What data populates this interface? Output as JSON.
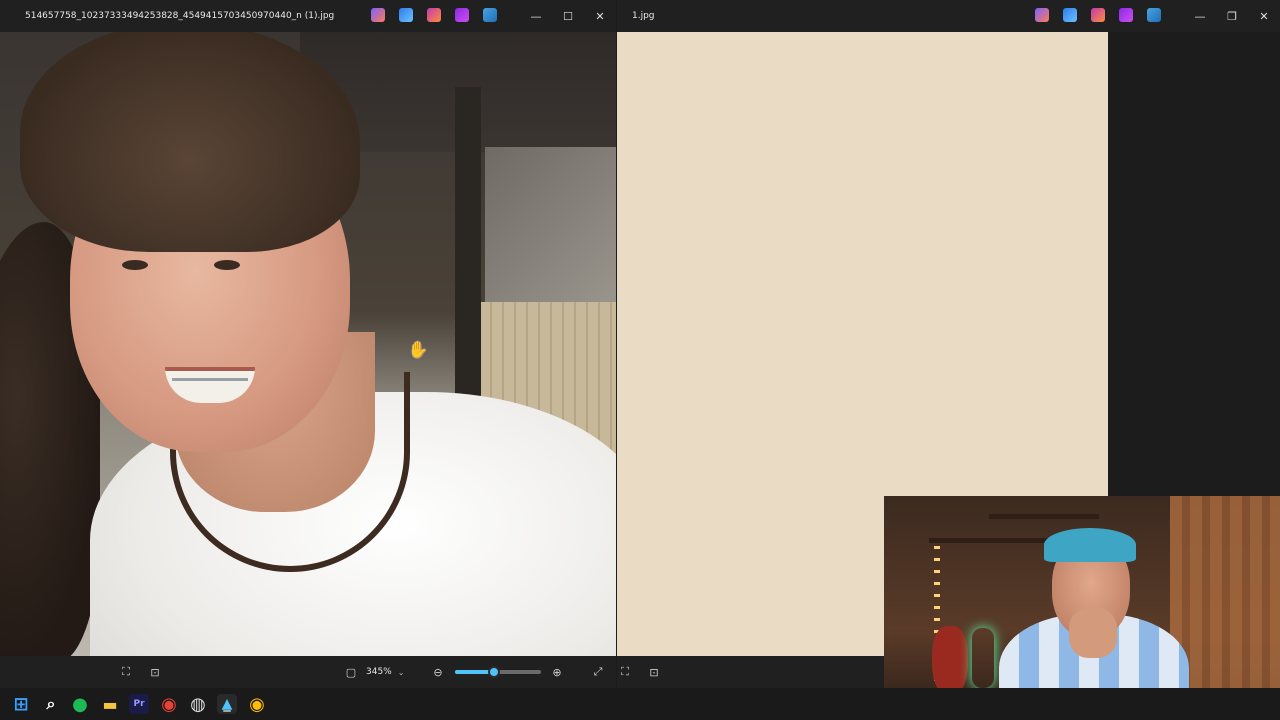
{
  "left_window": {
    "title": "514657758_10237333494253828_4549415703450970440_n (1).jpg",
    "app_icons": [
      {
        "name": "copilot-icon",
        "color": "#7b61ff"
      },
      {
        "name": "designer-icon",
        "color": "#2b7de9"
      },
      {
        "name": "paint-icon",
        "color": "#c239b3"
      },
      {
        "name": "clipchamp-icon",
        "color": "#8a2be2"
      },
      {
        "name": "onedrive-icon",
        "color": "#4aa3df"
      }
    ],
    "controls": {
      "minimize": "—",
      "maximize": "☐",
      "close": "✕"
    },
    "zoom_label": "345%",
    "zoom_level_percent": 45
  },
  "right_window": {
    "title": "1.jpg",
    "controls": {
      "minimize": "—",
      "restore": "❐",
      "close": "✕"
    }
  },
  "taskbar": {
    "items": [
      {
        "name": "start-icon",
        "glyph": "⊞",
        "color": "#3aa0ff"
      },
      {
        "name": "search-icon",
        "glyph": "⌕",
        "color": "#ffffff"
      },
      {
        "name": "spotify-icon",
        "glyph": "●",
        "color": "#1db954"
      },
      {
        "name": "file-explorer-icon",
        "glyph": "▬",
        "color": "#f5c542"
      },
      {
        "name": "premiere-pro-icon",
        "glyph": "Pr",
        "color": "#9999ff"
      },
      {
        "name": "chrome-icon",
        "glyph": "◉",
        "color": "#e94235"
      },
      {
        "name": "obs-icon",
        "glyph": "◍",
        "color": "#dddddd"
      },
      {
        "name": "photos-icon",
        "glyph": "▲",
        "color": "#4fc3f7"
      },
      {
        "name": "chrome-profile-icon",
        "glyph": "◉",
        "color": "#fbbc04"
      }
    ]
  }
}
